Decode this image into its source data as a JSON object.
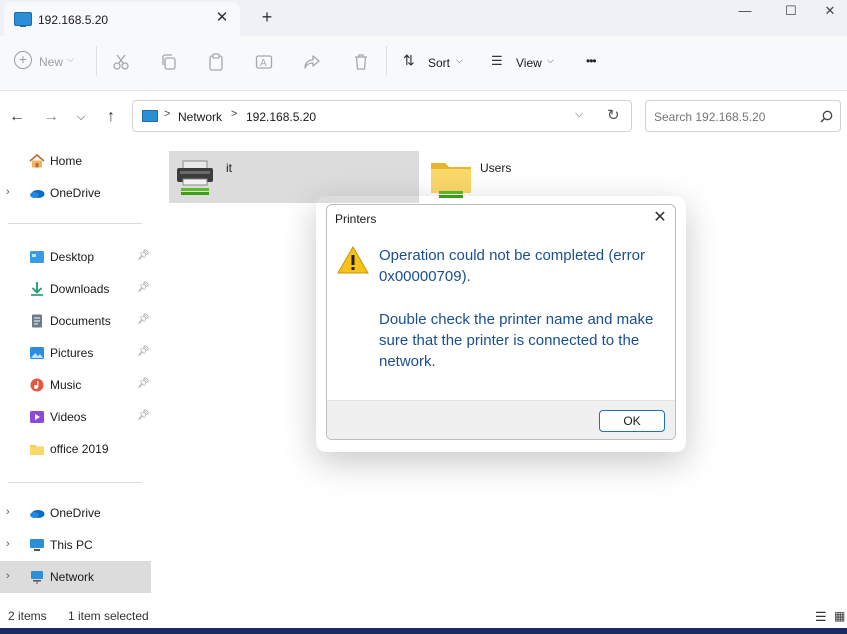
{
  "tab": {
    "title": "192.168.5.20",
    "close_glyph": "✕",
    "new_tab_glyph": "+"
  },
  "window_controls": {
    "minimize": "—",
    "maximize": "☐",
    "close": "✕"
  },
  "toolbar": {
    "new_label": "New",
    "sort_label": "Sort",
    "view_label": "View",
    "more_glyph": "•••"
  },
  "address": {
    "breadcrumb": [
      "Network",
      "192.168.5.20"
    ],
    "separator": ">",
    "search_placeholder": "Search 192.168.5.20"
  },
  "sidebar": {
    "top": [
      {
        "label": "Home",
        "icon": "home-icon",
        "chevron": false
      },
      {
        "label": "OneDrive",
        "icon": "cloud-icon",
        "chevron": true
      }
    ],
    "quick_access": [
      {
        "label": "Desktop",
        "icon": "desktop-icon",
        "pinned": true
      },
      {
        "label": "Downloads",
        "icon": "download-icon",
        "pinned": true
      },
      {
        "label": "Documents",
        "icon": "document-icon",
        "pinned": true
      },
      {
        "label": "Pictures",
        "icon": "picture-icon",
        "pinned": true
      },
      {
        "label": "Music",
        "icon": "music-icon",
        "pinned": true
      },
      {
        "label": "Videos",
        "icon": "video-icon",
        "pinned": true
      },
      {
        "label": "office 2019",
        "icon": "folder-icon",
        "pinned": false
      }
    ],
    "bottom": [
      {
        "label": "OneDrive",
        "icon": "cloud-icon",
        "selected": false
      },
      {
        "label": "This PC",
        "icon": "computer-icon",
        "selected": false
      },
      {
        "label": "Network",
        "icon": "network-icon",
        "selected": true
      }
    ]
  },
  "items": [
    {
      "name": "it",
      "icon": "printer-icon",
      "selected": true
    },
    {
      "name": "Users",
      "icon": "shared-folder-icon",
      "selected": false
    }
  ],
  "status": {
    "count": "2 items",
    "selection": "1 item selected"
  },
  "dialog": {
    "title": "Printers",
    "message": "Operation could not be completed (error 0x00000709).",
    "detail": "Double check the printer name and make sure that the printer is connected to the network.",
    "ok_label": "OK",
    "icon": "warning-icon"
  },
  "colors": {
    "accent": "#1f6fbf",
    "message_text": "#1a4f8f",
    "selected_bg": "#dcdcdc"
  }
}
